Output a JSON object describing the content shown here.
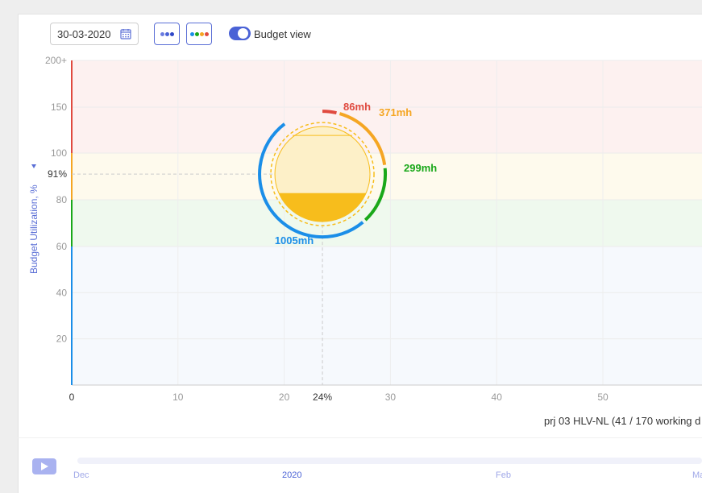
{
  "toolbar": {
    "date_value": "30-03-2020",
    "toggle_label": "Budget view",
    "toggle_on": true,
    "accent_color": "#4a62d6"
  },
  "colors": {
    "zone_red": "#fdf1f0",
    "zone_yellow": "#fefaed",
    "zone_green": "#eff9ee",
    "zone_blue": "#f6f9fd",
    "red": "#e04a3f",
    "orange": "#f5a623",
    "green": "#1aa81a",
    "blue": "#1b8ee8",
    "fill": "#f7bd1c"
  },
  "chart_data": {
    "type": "scatter",
    "ylabel": "Budget Utilization, %",
    "y_ticks": [
      "200+",
      "150",
      "100",
      "80",
      "60",
      "40",
      "20"
    ],
    "x_ticks": [
      "0",
      "10",
      "20",
      "30",
      "40",
      "50"
    ],
    "xlim": [
      0,
      59
    ],
    "ylim": [
      0,
      200
    ],
    "zones": [
      {
        "from": 100,
        "to": 200,
        "color": "red"
      },
      {
        "from": 80,
        "to": 100,
        "color": "yellow"
      },
      {
        "from": 60,
        "to": 80,
        "color": "green"
      },
      {
        "from": 0,
        "to": 60,
        "color": "blue"
      }
    ],
    "point": {
      "x": 23.6,
      "y": 91,
      "x_label": "24%",
      "y_label": "91%",
      "fill_fraction": 0.25,
      "segments": [
        {
          "label": "86mh",
          "value": 86,
          "color": "red"
        },
        {
          "label": "371mh",
          "value": 371,
          "color": "orange"
        },
        {
          "label": "299mh",
          "value": 299,
          "color": "green"
        },
        {
          "label": "1005mh",
          "value": 1005,
          "color": "blue"
        }
      ]
    },
    "caption": "prj 03 HLV-NL (41 / 170 working d"
  },
  "timeline": {
    "labels": [
      "Dec",
      "2020",
      "Feb",
      "Ma"
    ]
  }
}
